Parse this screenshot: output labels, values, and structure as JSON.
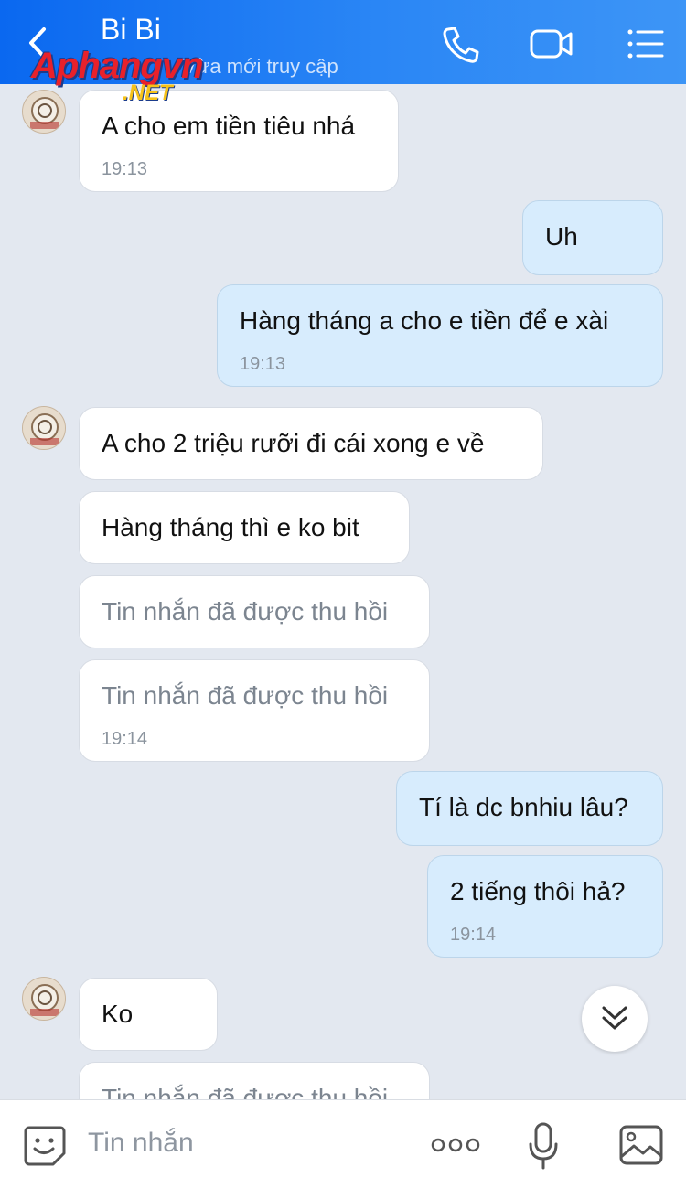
{
  "header": {
    "title": "Bi Bi",
    "subtitle": "Vừa mới truy cập"
  },
  "watermark": {
    "main": "Aphangvn",
    "suffix": ".NET"
  },
  "messages": [
    {
      "side": "in",
      "text": "A cho em tiền tiêu nhá",
      "time": "19:13"
    },
    {
      "side": "out",
      "text": "Uh"
    },
    {
      "side": "out",
      "text": "Hàng tháng a cho e tiền để e xài",
      "time": "19:13"
    },
    {
      "side": "in",
      "text": "A cho 2 triệu rưỡi đi cái xong e về"
    },
    {
      "side": "in",
      "text": "Hàng tháng thì e ko bit"
    },
    {
      "side": "in",
      "text": "Tin nhắn đã được thu hồi"
    },
    {
      "side": "in",
      "text": "Tin nhắn đã được thu hồi",
      "time": "19:14"
    },
    {
      "side": "out",
      "text": "Tí là dc bnhiu lâu?"
    },
    {
      "side": "out",
      "text": "2 tiếng thôi hả?",
      "time": "19:14"
    },
    {
      "side": "in",
      "text": "Ko"
    },
    {
      "side": "in",
      "text": "Tin nhắn đã được thu hồi"
    }
  ],
  "composer": {
    "placeholder": "Tin nhắn"
  },
  "icons": {
    "back": "chevron-left-icon",
    "call": "phone-icon",
    "video": "video-camera-icon",
    "menu": "list-menu-icon",
    "sticker": "emoji-sticker-icon",
    "more": "more-dots-icon",
    "mic": "microphone-icon",
    "image": "image-icon",
    "scroll": "double-chevron-down-icon"
  },
  "colors": {
    "header_start": "#0a68f0",
    "header_end": "#3d95f6",
    "out_bubble": "#d7ecfd",
    "in_bubble": "#ffffff",
    "background": "#e3e8f0"
  }
}
